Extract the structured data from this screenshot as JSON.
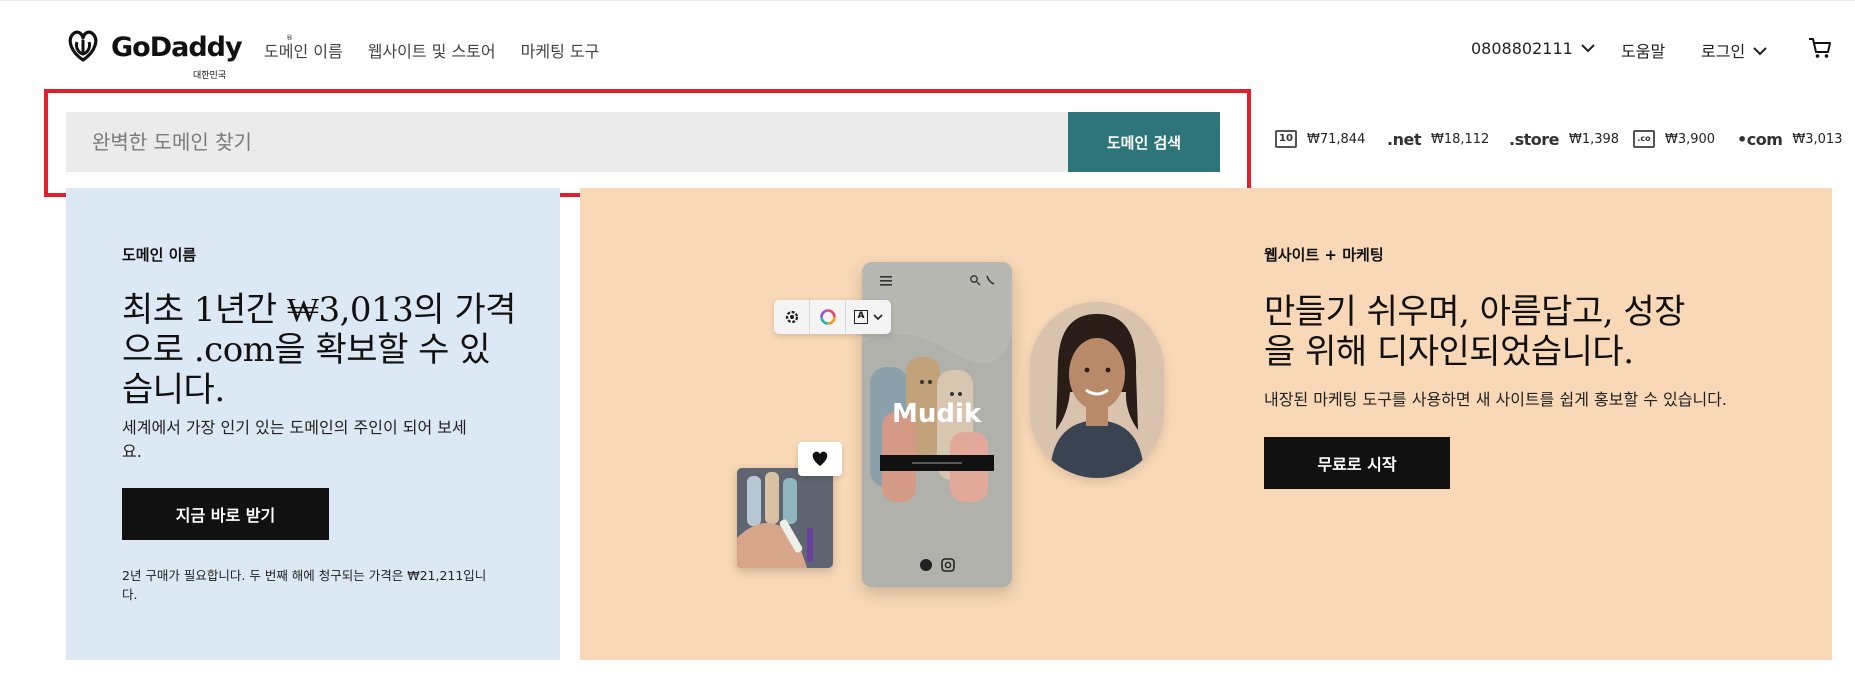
{
  "header": {
    "logo_text": "GoDaddy",
    "logo_tm": "®",
    "region": "대한민국",
    "nav": [
      {
        "label": "도메인 이름"
      },
      {
        "label": "웹사이트 및 스토어"
      },
      {
        "label": "마케팅 도구"
      }
    ],
    "phone": "0808802111",
    "help": "도움말",
    "login": "로그인",
    "icons": [
      "godaddy-logo-icon",
      "chevron-down-icon",
      "cart-icon"
    ]
  },
  "search": {
    "placeholder": "완벽한 도메인 찾기",
    "value": "",
    "button": "도메인 검색"
  },
  "tld_prices": [
    {
      "mark": "10",
      "icon": "io-badge-icon",
      "price": "₩71,844"
    },
    {
      "mark": ".net",
      "price": "₩18,112"
    },
    {
      "mark": ".store",
      "price": "₩1,398"
    },
    {
      "mark": ".co",
      "icon": "co-badge-icon",
      "price": "₩3,900"
    },
    {
      "mark": "•com",
      "price": "₩3,013"
    }
  ],
  "domain_card": {
    "eyebrow": "도메인 이름",
    "headline_l1": "최초 1년간 ₩3,013의 가격",
    "headline_l2": "으로 .com을 확보할 수 있",
    "headline_l3": "습니다.",
    "subtext_l1": "세계에서 가장 인기 있는 도메인의 주인이 되어 보세",
    "subtext_l2": "요.",
    "cta": "지금 바로 받기",
    "fine_l1": "2년 구매가 필요합니다. 두 번째 해에 청구되는 가격은 ₩21,211입니",
    "fine_l2": "다."
  },
  "website_card": {
    "eyebrow": "웹사이트 + 마케팅",
    "headline_l1": "만들기 쉬우며, 아름답고, 성장",
    "headline_l2": "을 위해 디자인되었습니다.",
    "subtext": "내장된 마케팅 도구를 사용하면 새 사이트를 쉽게 홍보할 수 있습니다.",
    "cta": "무료로 시작",
    "illustration": {
      "site_logo": "Mudik",
      "toolbar_font_glyph": "A"
    }
  },
  "colors": {
    "search_button": "#2e7579",
    "highlight_border": "#e2202b",
    "domain_card_bg": "#dde8f5",
    "website_card_bg": "#f8d8b6",
    "cta_bg": "#111111"
  }
}
